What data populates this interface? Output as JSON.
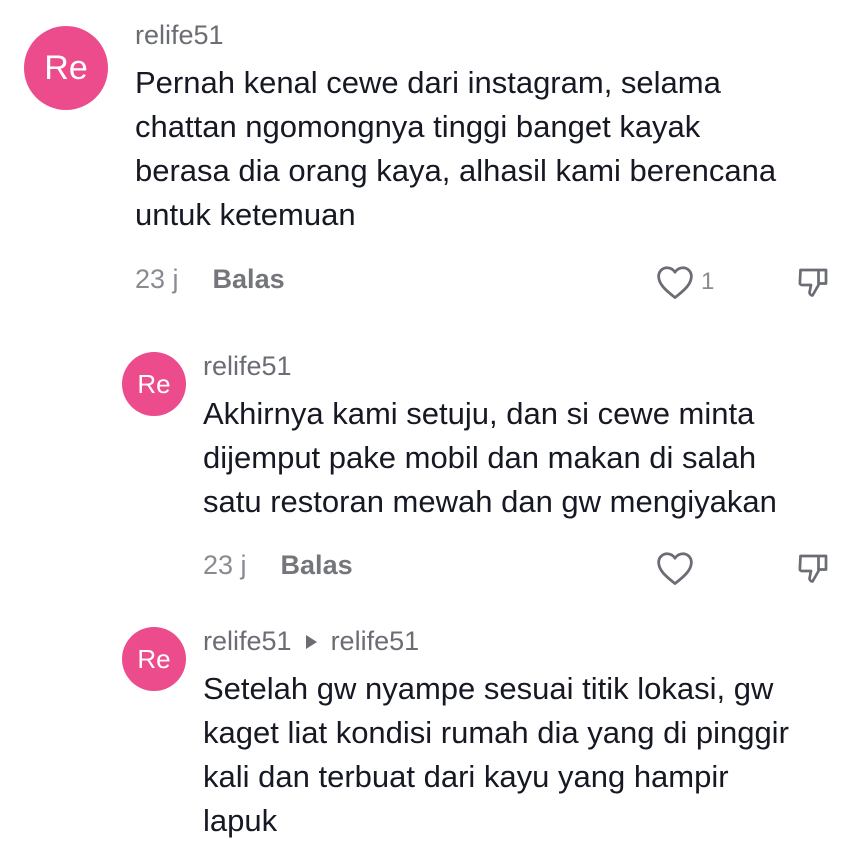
{
  "comments": [
    {
      "avatar_text": "Re",
      "username": "relife51",
      "text": "Pernah kenal cewe dari instagram, selama\nchattan ngomongnya tinggi banget kayak\nberasa dia orang kaya, alhasil kami berencana\nuntuk ketemuan",
      "time": "23 j",
      "reply_label": "Balas",
      "like_count": "1"
    },
    {
      "avatar_text": "Re",
      "username": "relife51",
      "text": "Akhirnya kami setuju, dan si cewe minta\ndijemput pake mobil dan makan di salah\nsatu restoran mewah dan gw mengiyakan",
      "time": "23 j",
      "reply_label": "Balas"
    },
    {
      "avatar_text": "Re",
      "username": "relife51",
      "reply_to": "relife51",
      "text": "Setelah gw nyampe sesuai titik lokasi, gw\nkaget liat kondisi rumah dia yang di pinggir\nkali dan terbuat dari kayu yang hampir\nlapuk"
    }
  ],
  "colors": {
    "avatar": "#ec4c8b",
    "text": "#161823",
    "secondary": "#8a8b91"
  },
  "icons": [
    "heart-outline-icon",
    "thumbs-down-icon",
    "reply-arrow-icon"
  ]
}
